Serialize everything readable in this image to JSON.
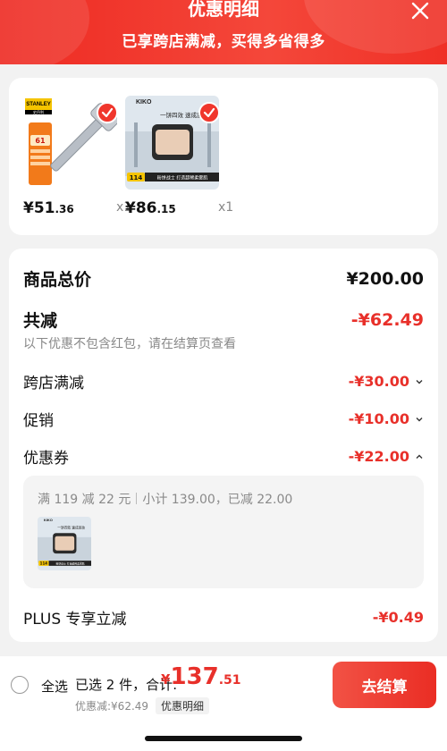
{
  "header": {
    "title": "优惠明细",
    "subtitle": "已享跨店满减，买得多省得多",
    "close_icon": "close-icon"
  },
  "products": [
    {
      "brand": "STANLEY",
      "brand_sub": "史丹利",
      "badge_num": "61",
      "price_int": "¥51",
      "price_dec": ".36",
      "qty": "x1",
      "selected": true
    },
    {
      "brand": "KIKO",
      "caption_line": "一饼四效 速成底妆",
      "price_tag": "114",
      "bottom_caption": "粉饼战士 打造超稀柔雾肌",
      "price_int": "¥86",
      "price_dec": ".15",
      "qty": "x1",
      "selected": true
    }
  ],
  "summary": {
    "total_label": "商品总价",
    "total_value": "¥200.00",
    "reduce_label": "共减",
    "reduce_value": "-¥62.49",
    "note": "以下优惠不包含红包，请在结算页查看",
    "rows": [
      {
        "label": "跨店满减",
        "value": "-¥30.00",
        "chevron": "chevron-down-icon"
      },
      {
        "label": "促销",
        "value": "-¥10.00",
        "chevron": "chevron-down-icon"
      },
      {
        "label": "优惠券",
        "value": "-¥22.00",
        "chevron": "chevron-up-icon"
      }
    ],
    "coupon": {
      "rule": "满 119 减 22 元",
      "subtotal": "小计 139.00，已减 22.00"
    },
    "plus_label": "PLUS 专享立减",
    "plus_value": "-¥0.49"
  },
  "bottom": {
    "select_all": "全选",
    "selected_count": "已选 2 件，合计:",
    "total_currency": "¥",
    "total_int": "137",
    "total_dec": ".51",
    "discount": "优惠减:¥62.49",
    "detail_link": "优惠明细",
    "checkout": "去结算"
  },
  "colors": {
    "accent": "#e8302a",
    "header_red": "#ef3026",
    "checkout_red": "#ea2d24"
  }
}
